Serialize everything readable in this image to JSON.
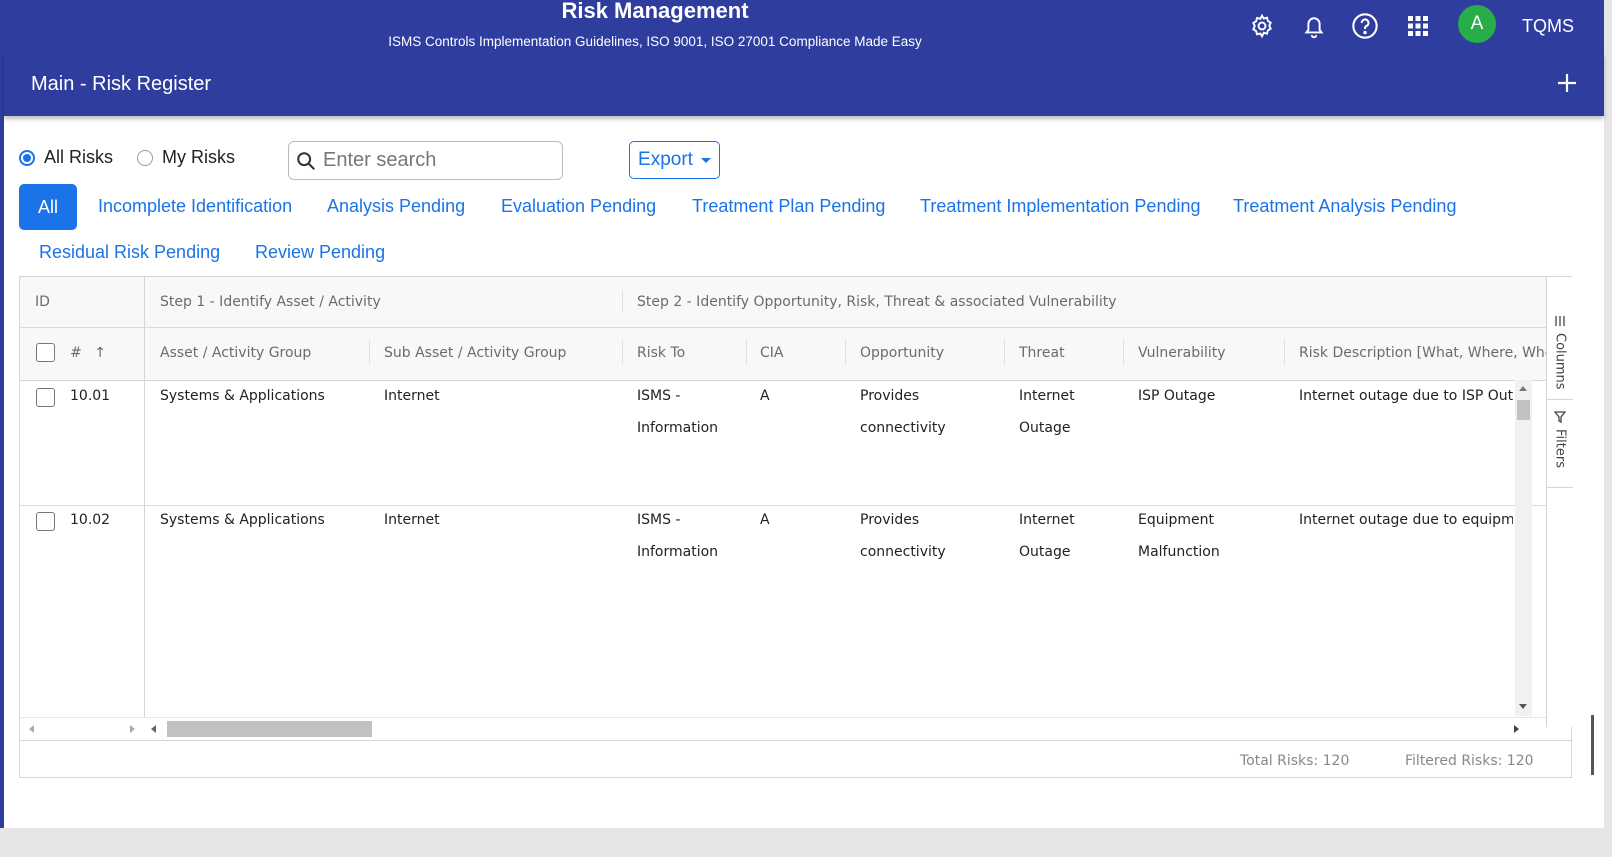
{
  "header": {
    "title": "Risk Management",
    "subtitle": "ISMS Controls Implementation Guidelines, ISO 9001, ISO 27001 Compliance Made Easy",
    "icons": [
      "gear-icon",
      "bell-icon",
      "help-icon",
      "apps-grid-icon"
    ],
    "avatar_initial": "A",
    "org_name": "TQMS",
    "color": "#2f3e9e"
  },
  "subheader": {
    "page_title": "Main - Risk Register",
    "add_icon": "plus-icon"
  },
  "filters": {
    "radio_all": "All Risks",
    "radio_mine": "My Risks",
    "selected": "All Risks",
    "search_placeholder": "Enter search",
    "export_label": "Export"
  },
  "tabs": [
    {
      "label": "All",
      "active": true
    },
    {
      "label": "Incomplete Identification"
    },
    {
      "label": "Analysis Pending"
    },
    {
      "label": "Evaluation Pending"
    },
    {
      "label": "Treatment Plan Pending"
    },
    {
      "label": "Treatment Implementation Pending"
    },
    {
      "label": "Treatment Analysis Pending"
    },
    {
      "label": "Residual Risk Pending"
    },
    {
      "label": "Review Pending"
    }
  ],
  "grid": {
    "group_headers": {
      "id": "ID",
      "step1": "Step 1 - Identify Asset / Activity",
      "step2": "Step 2 - Identify Opportunity, Risk, Threat & associated Vulnerability"
    },
    "columns": {
      "num": "#",
      "asset_group": "Asset / Activity Group",
      "sub_asset_group": "Sub Asset / Activity Group",
      "risk_to": "Risk To",
      "cia": "CIA",
      "opportunity": "Opportunity",
      "threat": "Threat",
      "vulnerability": "Vulnerability",
      "risk_description": "Risk Description [What, Where, When"
    },
    "rows": [
      {
        "id": "10.01",
        "asset_group": "Systems & Applications",
        "sub_asset_group": "Internet",
        "risk_to_1": "ISMS -",
        "risk_to_2": "Information",
        "cia": "A",
        "opportunity_1": "Provides",
        "opportunity_2": "connectivity",
        "threat_1": "Internet",
        "threat_2": "Outage",
        "vulnerability_1": "ISP Outage",
        "vulnerability_2": "",
        "risk_description": "Internet outage due to ISP Outage"
      },
      {
        "id": "10.02",
        "asset_group": "Systems & Applications",
        "sub_asset_group": "Internet",
        "risk_to_1": "ISMS -",
        "risk_to_2": "Information",
        "cia": "A",
        "opportunity_1": "Provides",
        "opportunity_2": "connectivity",
        "threat_1": "Internet",
        "threat_2": "Outage",
        "vulnerability_1": "Equipment",
        "vulnerability_2": "Malfunction",
        "risk_description": "Internet outage due to equipment"
      }
    ],
    "side_panel": {
      "columns": "Columns",
      "filters": "Filters"
    },
    "total_risks": "Total Risks: 120",
    "filtered_risks": "Filtered Risks: 120"
  },
  "colors": {
    "primary": "#2f3e9e",
    "accent": "#1a73e8",
    "avatar": "#27ae48"
  }
}
